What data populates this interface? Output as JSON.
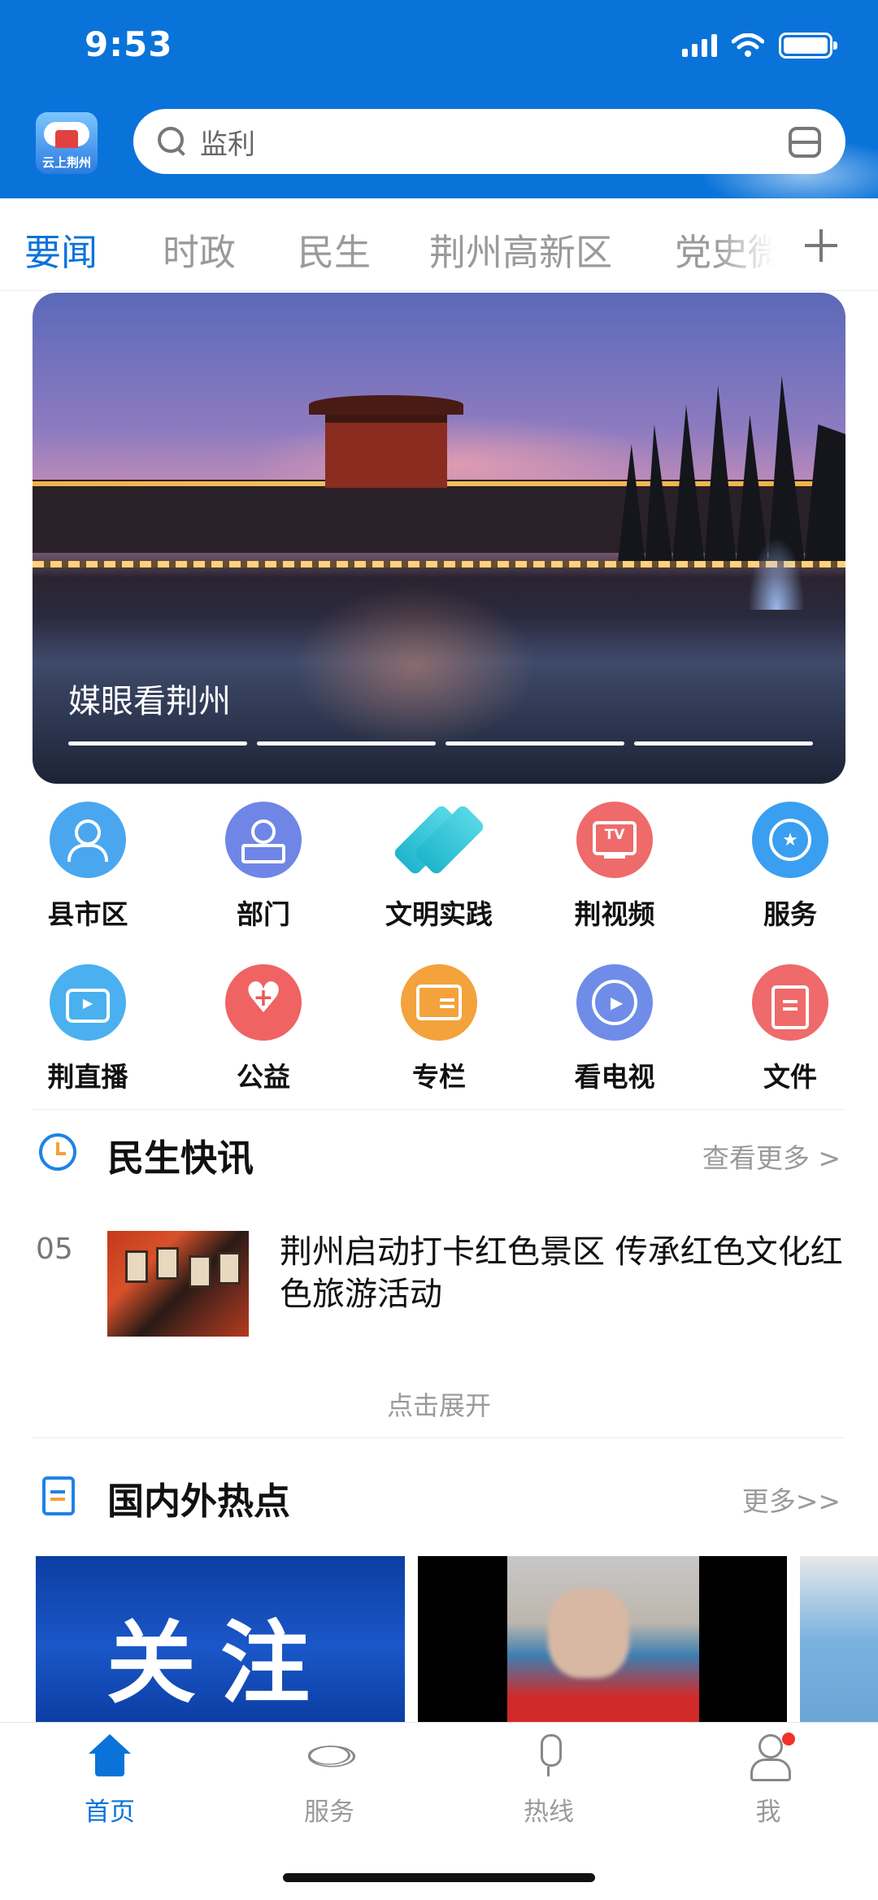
{
  "status_bar": {
    "time": "9:53"
  },
  "app": {
    "logo_text": "云上荆州"
  },
  "search": {
    "text": "监利"
  },
  "tabs": [
    {
      "label": "要闻",
      "active": true
    },
    {
      "label": "时政",
      "active": false
    },
    {
      "label": "民生",
      "active": false
    },
    {
      "label": "荆州高新区",
      "active": false
    },
    {
      "label": "党史微",
      "active": false
    }
  ],
  "banner": {
    "title": "媒眼看荆州",
    "slide_count": 4
  },
  "grid": [
    {
      "label": "县市区",
      "icon": "person-icon",
      "color": "#4aa7ef"
    },
    {
      "label": "部门",
      "icon": "stamp-icon",
      "color": "#6f86e6"
    },
    {
      "label": "文明实践",
      "icon": "civilization-logo-icon",
      "color": "#2fc4d8"
    },
    {
      "label": "荆视频",
      "icon": "tv-icon",
      "color": "#ef6a6a"
    },
    {
      "label": "服务",
      "icon": "star-badge-icon",
      "color": "#3a9ff0"
    },
    {
      "label": "荆直播",
      "icon": "live-camera-icon",
      "color": "#4ab0ef"
    },
    {
      "label": "公益",
      "icon": "heart-plus-icon",
      "color": "#ef6363"
    },
    {
      "label": "专栏",
      "icon": "id-card-icon",
      "color": "#f4a23b"
    },
    {
      "label": "看电视",
      "icon": "play-icon",
      "color": "#6f8de8"
    },
    {
      "label": "文件",
      "icon": "clipboard-icon",
      "color": "#ef6a6a"
    }
  ],
  "livelihood": {
    "title": "民生快讯",
    "more": "查看更多 >",
    "items": [
      {
        "number": "05",
        "headline": "荆州启动打卡红色景区 传承红色文化红色旅游活动"
      }
    ],
    "expand": "点击展开"
  },
  "hotspots": {
    "title": "国内外热点",
    "more": "更多>>",
    "image1_text": "关注"
  },
  "bottom_nav": [
    {
      "label": "首页",
      "icon": "home-icon",
      "active": true
    },
    {
      "label": "服务",
      "icon": "atom-icon",
      "active": false
    },
    {
      "label": "热线",
      "icon": "microphone-icon",
      "active": false
    },
    {
      "label": "我",
      "icon": "user-icon",
      "active": false,
      "badge": true
    }
  ],
  "colors": {
    "brand": "#0a73d9",
    "muted": "#9a9a9a",
    "badge": "#f0302a"
  }
}
